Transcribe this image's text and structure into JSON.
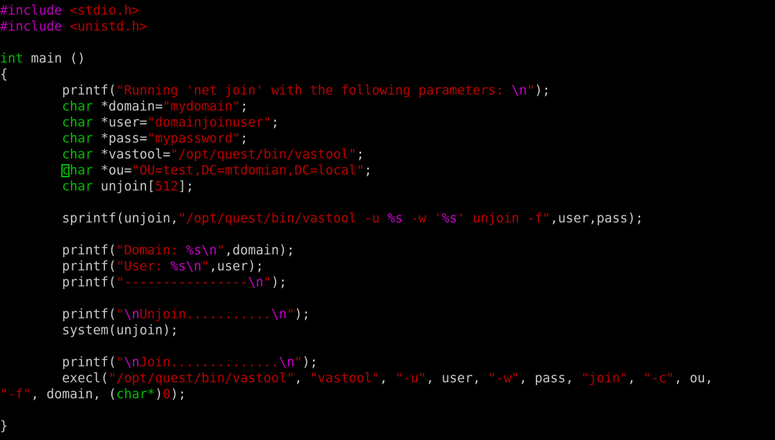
{
  "window": {
    "title": "vim - join.c",
    "background_color": "#000000",
    "mode": "normal"
  },
  "theme": {
    "background": "#000000",
    "foreground": "#c8c8c8",
    "keyword": "#00bb00",
    "preprocessor": "#bb00bb",
    "string": "#bb0000",
    "format_specifier": "#cc00cc",
    "number": "#bb0000",
    "cursor": "#00bb00"
  },
  "cursor": {
    "line": 10,
    "column": 9,
    "character": "c",
    "shape": "hollow-block",
    "color": "#00bb00"
  },
  "code": {
    "language": "c",
    "lines": [
      {
        "n": 1,
        "tokens": [
          {
            "t": "#include ",
            "c": "pre"
          },
          {
            "t": "<stdio.h>",
            "c": "string"
          }
        ]
      },
      {
        "n": 2,
        "tokens": [
          {
            "t": "#include ",
            "c": "pre"
          },
          {
            "t": "<unistd.h>",
            "c": "string"
          }
        ]
      },
      {
        "n": 3,
        "tokens": []
      },
      {
        "n": 4,
        "tokens": [
          {
            "t": "int",
            "c": "keyword"
          },
          {
            "t": " main ()",
            "c": "plain"
          }
        ]
      },
      {
        "n": 5,
        "tokens": [
          {
            "t": "{",
            "c": "plain"
          }
        ]
      },
      {
        "n": 6,
        "tokens": [
          {
            "t": "        printf(",
            "c": "plain"
          },
          {
            "t": "\"Running 'net join' with the following parameters: ",
            "c": "string"
          },
          {
            "t": "\\n",
            "c": "fmt"
          },
          {
            "t": "\"",
            "c": "string"
          },
          {
            "t": ");",
            "c": "plain"
          }
        ]
      },
      {
        "n": 7,
        "tokens": [
          {
            "t": "        ",
            "c": "plain"
          },
          {
            "t": "char",
            "c": "keyword"
          },
          {
            "t": " *domain=",
            "c": "plain"
          },
          {
            "t": "\"mydomain\"",
            "c": "string"
          },
          {
            "t": ";",
            "c": "plain"
          }
        ]
      },
      {
        "n": 8,
        "tokens": [
          {
            "t": "        ",
            "c": "plain"
          },
          {
            "t": "char",
            "c": "keyword"
          },
          {
            "t": " *user=",
            "c": "plain"
          },
          {
            "t": "\"domainjoinuser\"",
            "c": "string"
          },
          {
            "t": ";",
            "c": "plain"
          }
        ]
      },
      {
        "n": 9,
        "tokens": [
          {
            "t": "        ",
            "c": "plain"
          },
          {
            "t": "char",
            "c": "keyword"
          },
          {
            "t": " *pass=",
            "c": "plain"
          },
          {
            "t": "\"mypassword\"",
            "c": "string"
          },
          {
            "t": ";",
            "c": "plain"
          }
        ]
      },
      {
        "n": 10,
        "tokens": [
          {
            "t": "        ",
            "c": "plain"
          },
          {
            "t": "char",
            "c": "keyword"
          },
          {
            "t": " *vastool=",
            "c": "plain"
          },
          {
            "t": "\"/opt/quest/bin/vastool\"",
            "c": "string"
          },
          {
            "t": ";",
            "c": "plain"
          }
        ]
      },
      {
        "n": 11,
        "cursor_at": 8,
        "tokens": [
          {
            "t": "        ",
            "c": "plain"
          },
          {
            "t": "char",
            "c": "keyword"
          },
          {
            "t": " *ou=",
            "c": "plain"
          },
          {
            "t": "\"OU=test,DC=mtdomian,DC=local\"",
            "c": "string"
          },
          {
            "t": ";",
            "c": "plain"
          }
        ]
      },
      {
        "n": 12,
        "tokens": [
          {
            "t": "        ",
            "c": "plain"
          },
          {
            "t": "char",
            "c": "keyword"
          },
          {
            "t": " unjoin[",
            "c": "plain"
          },
          {
            "t": "512",
            "c": "number"
          },
          {
            "t": "];",
            "c": "plain"
          }
        ]
      },
      {
        "n": 13,
        "tokens": []
      },
      {
        "n": 14,
        "tokens": [
          {
            "t": "        sprintf(unjoin,",
            "c": "plain"
          },
          {
            "t": "\"/opt/quest/bin/vastool -u ",
            "c": "string"
          },
          {
            "t": "%s",
            "c": "fmt"
          },
          {
            "t": " -w '",
            "c": "string"
          },
          {
            "t": "%s",
            "c": "fmt"
          },
          {
            "t": "' unjoin -f\"",
            "c": "string"
          },
          {
            "t": ",user,pass);",
            "c": "plain"
          }
        ]
      },
      {
        "n": 15,
        "tokens": []
      },
      {
        "n": 16,
        "tokens": [
          {
            "t": "        printf(",
            "c": "plain"
          },
          {
            "t": "\"Domain: ",
            "c": "string"
          },
          {
            "t": "%s\\n",
            "c": "fmt"
          },
          {
            "t": "\"",
            "c": "string"
          },
          {
            "t": ",domain);",
            "c": "plain"
          }
        ]
      },
      {
        "n": 17,
        "tokens": [
          {
            "t": "        printf(",
            "c": "plain"
          },
          {
            "t": "\"User: ",
            "c": "string"
          },
          {
            "t": "%s\\n",
            "c": "fmt"
          },
          {
            "t": "\"",
            "c": "string"
          },
          {
            "t": ",user);",
            "c": "plain"
          }
        ]
      },
      {
        "n": 18,
        "tokens": [
          {
            "t": "        printf(",
            "c": "plain"
          },
          {
            "t": "\"----------------",
            "c": "string"
          },
          {
            "t": "\\n",
            "c": "fmt"
          },
          {
            "t": "\"",
            "c": "string"
          },
          {
            "t": ");",
            "c": "plain"
          }
        ]
      },
      {
        "n": 19,
        "tokens": []
      },
      {
        "n": 20,
        "tokens": [
          {
            "t": "        printf(",
            "c": "plain"
          },
          {
            "t": "\"",
            "c": "string"
          },
          {
            "t": "\\n",
            "c": "fmt"
          },
          {
            "t": "Unjoin...........",
            "c": "string"
          },
          {
            "t": "\\n",
            "c": "fmt"
          },
          {
            "t": "\"",
            "c": "string"
          },
          {
            "t": ");",
            "c": "plain"
          }
        ]
      },
      {
        "n": 21,
        "tokens": [
          {
            "t": "        system(unjoin);",
            "c": "plain"
          }
        ]
      },
      {
        "n": 22,
        "tokens": []
      },
      {
        "n": 23,
        "tokens": [
          {
            "t": "        printf(",
            "c": "plain"
          },
          {
            "t": "\"",
            "c": "string"
          },
          {
            "t": "\\n",
            "c": "fmt"
          },
          {
            "t": "Join..............",
            "c": "string"
          },
          {
            "t": "\\n",
            "c": "fmt"
          },
          {
            "t": "\"",
            "c": "string"
          },
          {
            "t": ");",
            "c": "plain"
          }
        ]
      },
      {
        "n": 24,
        "tokens": [
          {
            "t": "        execl(",
            "c": "plain"
          },
          {
            "t": "\"/opt/quest/bin/vastool\"",
            "c": "string"
          },
          {
            "t": ", ",
            "c": "plain"
          },
          {
            "t": "\"vastool\"",
            "c": "string"
          },
          {
            "t": ", ",
            "c": "plain"
          },
          {
            "t": "\"-u\"",
            "c": "string"
          },
          {
            "t": ", user, ",
            "c": "plain"
          },
          {
            "t": "\"-w\"",
            "c": "string"
          },
          {
            "t": ", pass, ",
            "c": "plain"
          },
          {
            "t": "\"join\"",
            "c": "string"
          },
          {
            "t": ", ",
            "c": "plain"
          },
          {
            "t": "\"-c\"",
            "c": "string"
          },
          {
            "t": ", ou,",
            "c": "plain"
          }
        ]
      },
      {
        "n": 25,
        "tokens": [
          {
            "t": "\"-f\"",
            "c": "string"
          },
          {
            "t": ", domain, (",
            "c": "plain"
          },
          {
            "t": "char",
            "c": "keyword"
          },
          {
            "t": "*",
            "c": "keyword"
          },
          {
            "t": ")",
            "c": "plain"
          },
          {
            "t": "0",
            "c": "number"
          },
          {
            "t": ");",
            "c": "plain"
          }
        ]
      },
      {
        "n": 26,
        "tokens": []
      },
      {
        "n": 27,
        "tokens": [
          {
            "t": "}",
            "c": "plain"
          }
        ]
      }
    ]
  }
}
